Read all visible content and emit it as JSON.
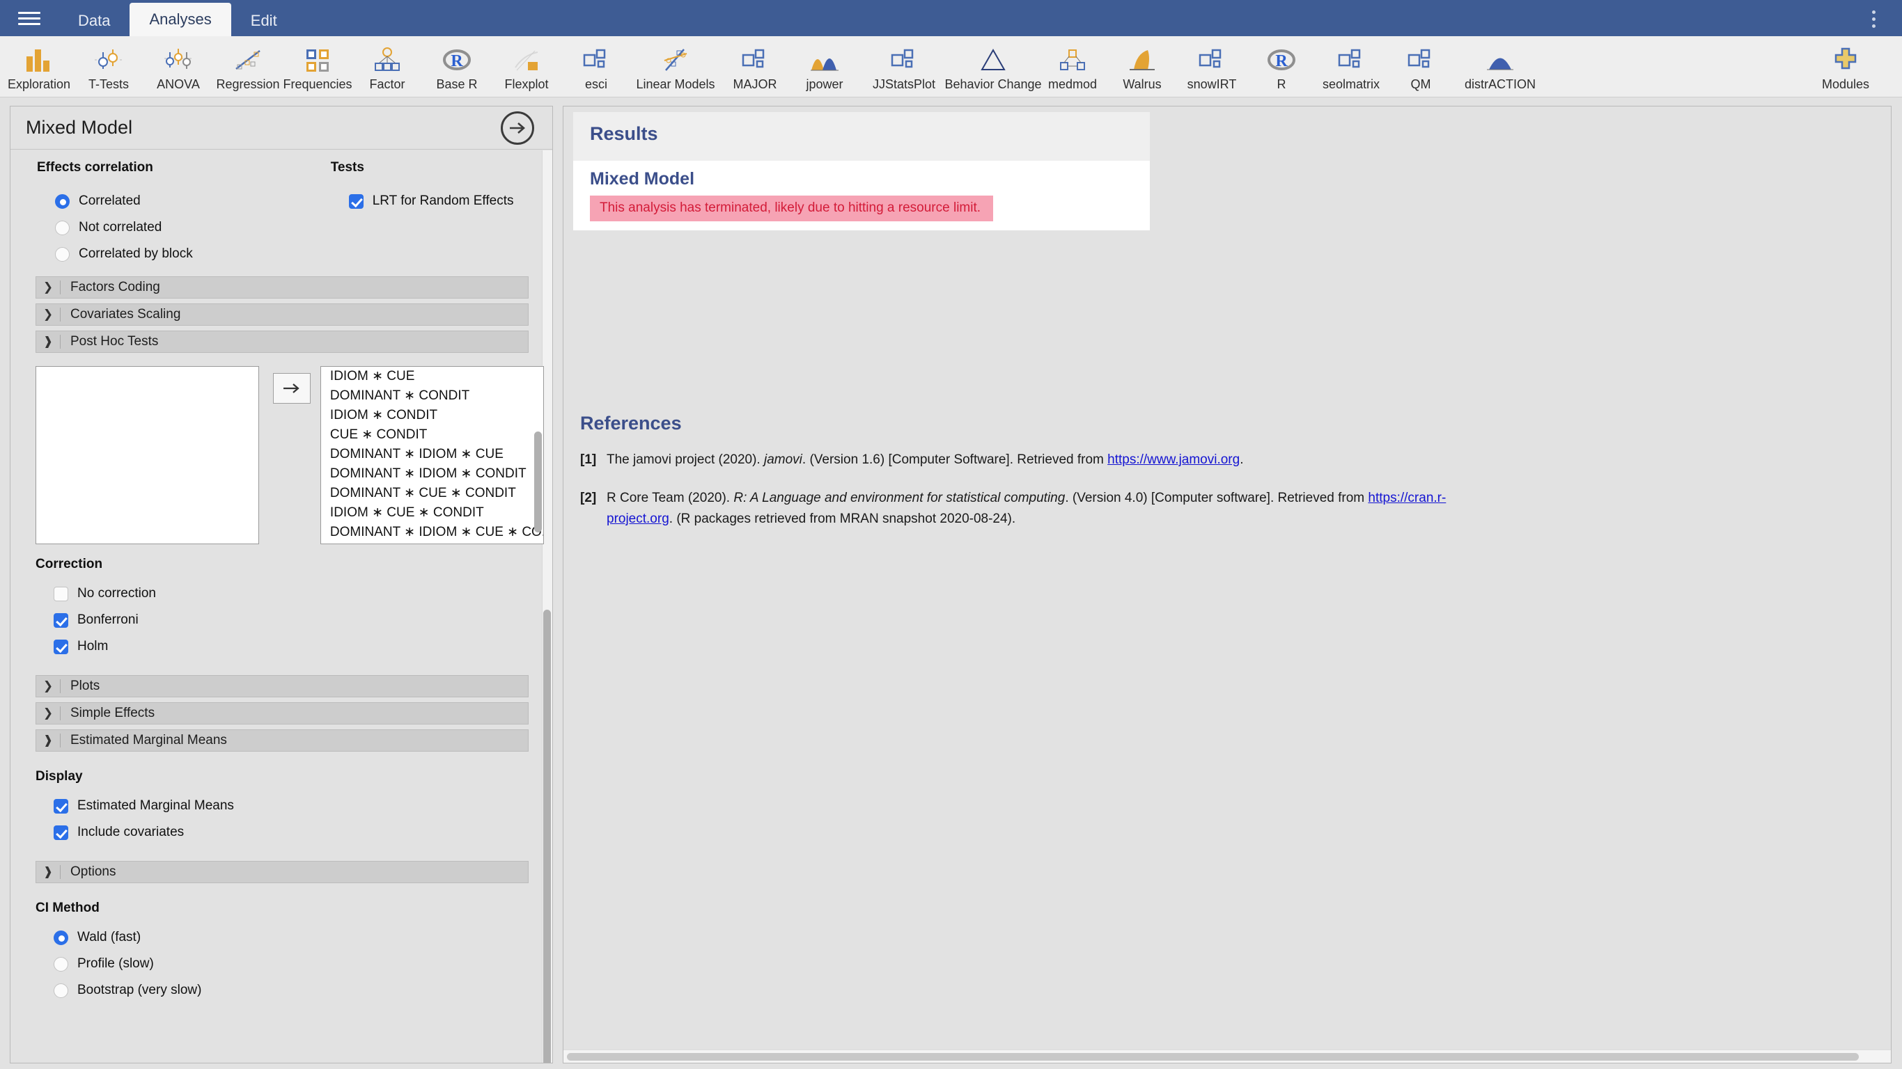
{
  "titlebar": {
    "menu_icon": "hamburger-icon",
    "tabs": [
      {
        "label": "Data",
        "active": false
      },
      {
        "label": "Analyses",
        "active": true
      },
      {
        "label": "Edit",
        "active": false
      }
    ],
    "overflow_icon": "vertical-ellipsis-icon"
  },
  "ribbon": {
    "items": [
      {
        "label": "Exploration",
        "icon": "bar-chart-icon"
      },
      {
        "label": "T-Tests",
        "icon": "error-bars-icon"
      },
      {
        "label": "ANOVA",
        "icon": "error-bars-triple-icon"
      },
      {
        "label": "Regression",
        "icon": "scatter-line-icon"
      },
      {
        "label": "Frequencies",
        "icon": "four-squares-icon"
      },
      {
        "label": "Factor",
        "icon": "factor-tree-icon"
      },
      {
        "label": "Base R",
        "icon": "r-logo-icon"
      },
      {
        "label": "Flexplot",
        "icon": "flexplot-icon"
      },
      {
        "label": "esci",
        "icon": "module-squares-icon"
      },
      {
        "label": "Linear Models",
        "icon": "linear-models-icon"
      },
      {
        "label": "MAJOR",
        "icon": "module-squares-icon"
      },
      {
        "label": "jpower",
        "icon": "two-curves-icon"
      },
      {
        "label": "JJStatsPlot",
        "icon": "module-squares-icon"
      },
      {
        "label": "Behavior Change",
        "icon": "triangle-icon"
      },
      {
        "label": "medmod",
        "icon": "mediation-tree-icon"
      },
      {
        "label": "Walrus",
        "icon": "walrus-icon"
      },
      {
        "label": "snowIRT",
        "icon": "module-squares-icon"
      },
      {
        "label": "R",
        "icon": "r-logo-icon"
      },
      {
        "label": "seolmatrix",
        "icon": "module-squares-icon"
      },
      {
        "label": "QM",
        "icon": "module-squares-icon"
      },
      {
        "label": "distrACTION",
        "icon": "normal-curve-icon"
      }
    ],
    "modules": {
      "label": "Modules",
      "icon": "plus-icon"
    }
  },
  "options_panel": {
    "title": "Mixed Model",
    "collapse_icon": "arrow-right-circle-icon",
    "effects_correlation": {
      "label": "Effects correlation",
      "options": [
        {
          "label": "Correlated",
          "selected": true
        },
        {
          "label": "Not correlated",
          "selected": false
        },
        {
          "label": "Correlated by block",
          "selected": false
        }
      ]
    },
    "tests": {
      "label": "Tests",
      "options": [
        {
          "label": "LRT for Random Effects",
          "checked": true
        }
      ]
    },
    "sections": [
      {
        "title": "Factors Coding",
        "expanded": false,
        "chevron": "chevron-right-icon"
      },
      {
        "title": "Covariates Scaling",
        "expanded": false,
        "chevron": "chevron-right-icon"
      },
      {
        "title": "Post Hoc Tests",
        "expanded": true,
        "chevron": "chevron-down-icon"
      },
      {
        "title": "Plots",
        "expanded": false,
        "chevron": "chevron-right-icon"
      },
      {
        "title": "Simple Effects",
        "expanded": false,
        "chevron": "chevron-right-icon"
      },
      {
        "title": "Estimated Marginal Means",
        "expanded": true,
        "chevron": "chevron-down-icon"
      },
      {
        "title": "Options",
        "expanded": true,
        "chevron": "chevron-down-icon"
      }
    ],
    "post_hoc": {
      "transfer_icon": "arrow-right-icon",
      "selected_items": [],
      "available_items": [
        "IDIOM ∗ CUE",
        "DOMINANT ∗ CONDIT",
        "IDIOM ∗ CONDIT",
        "CUE ∗ CONDIT",
        "DOMINANT ∗ IDIOM ∗ CUE",
        "DOMINANT ∗ IDIOM ∗ CONDIT",
        "DOMINANT ∗ CUE ∗ CONDIT",
        "IDIOM ∗ CUE ∗ CONDIT",
        "DOMINANT ∗ IDIOM ∗ CUE ∗ CO..."
      ]
    },
    "correction": {
      "label": "Correction",
      "options": [
        {
          "label": "No correction",
          "checked": false
        },
        {
          "label": "Bonferroni",
          "checked": true
        },
        {
          "label": "Holm",
          "checked": true
        }
      ]
    },
    "display": {
      "label": "Display",
      "options": [
        {
          "label": "Estimated Marginal Means",
          "checked": true
        },
        {
          "label": "Include covariates",
          "checked": true
        }
      ]
    },
    "ci_method": {
      "label": "CI Method",
      "options": [
        {
          "label": "Wald (fast)",
          "selected": true
        },
        {
          "label": "Profile (slow)",
          "selected": false
        },
        {
          "label": "Bootstrap (very slow)",
          "selected": false
        }
      ]
    }
  },
  "results": {
    "heading": "Results",
    "analysis_title": "Mixed Model",
    "error_message": "This analysis has terminated, likely due to hitting a resource limit.",
    "error_bg_color": "#f6a3b4",
    "error_text_color": "#d31b38",
    "heading_color": "#3b4e8a",
    "references": {
      "heading": "References",
      "items": [
        {
          "num": "[1]",
          "pre": "The jamovi project (2020). ",
          "italic": "jamovi",
          "mid": ". (Version 1.6) [Computer Software]. Retrieved from ",
          "link": "https://www.jamovi.org",
          "post": "."
        },
        {
          "num": "[2]",
          "pre": "R Core Team (2020). ",
          "italic": "R: A Language and environment for statistical computing",
          "mid": ". (Version 4.0) [Computer software]. Retrieved from ",
          "link": "https://cran.r-project.org",
          "post": ". (R packages retrieved from MRAN snapshot 2020-08-24)."
        }
      ]
    }
  }
}
